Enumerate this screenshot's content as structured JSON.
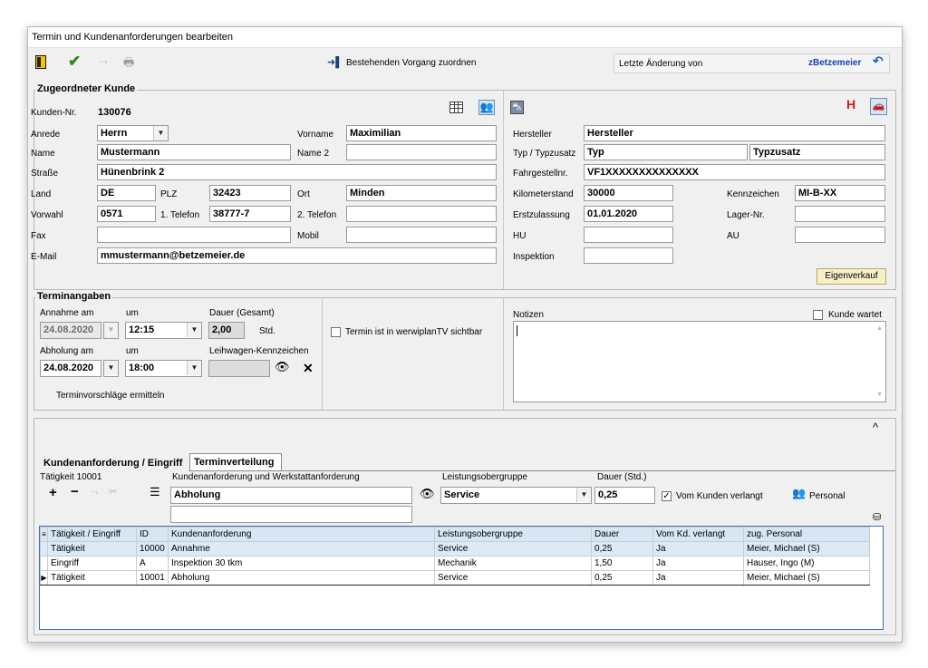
{
  "window": {
    "title": "Termin und Kundenanforderungen bearbeiten"
  },
  "toolbar": {
    "assign_label": "Bestehenden Vorgang zuordnen",
    "last_change_label": "Letzte Änderung von",
    "last_change_user": "zBetzemeier"
  },
  "customer": {
    "group_title": "Zugeordneter Kunde",
    "number_label": "Kunden-Nr.",
    "number": "130076",
    "salutation_label": "Anrede",
    "salutation": "Herrn",
    "firstname_label": "Vorname",
    "firstname": "Maximilian",
    "name_label": "Name",
    "name": "Mustermann",
    "name2_label": "Name 2",
    "name2": "",
    "street_label": "Straße",
    "street": "Hünenbrink 2",
    "country_label": "Land",
    "country": "DE",
    "zip_label": "PLZ",
    "zip": "32423",
    "city_label": "Ort",
    "city": "Minden",
    "areacode_label": "Vorwahl",
    "areacode": "0571",
    "phone1_label": "1. Telefon",
    "phone1": "38777-7",
    "phone2_label": "2. Telefon",
    "phone2": "",
    "fax_label": "Fax",
    "fax": "",
    "mobile_label": "Mobil",
    "mobile": "",
    "email_label": "E-Mail",
    "email": "mmustermann@betzemeier.de"
  },
  "vehicle": {
    "h_badge": "H",
    "maker_label": "Hersteller",
    "maker": "Hersteller",
    "type_label": "Typ / Typzusatz",
    "type": "Typ",
    "type_suffix": "Typzusatz",
    "vin_label": "Fahrgestellnr.",
    "vin": "VF1XXXXXXXXXXXXXX",
    "mileage_label": "Kilometerstand",
    "mileage": "30000",
    "plate_label": "Kennzeichen",
    "plate": "MI-B-XX",
    "reg_label": "Erstzulassung",
    "reg": "01.01.2020",
    "storage_label": "Lager-Nr.",
    "storage": "",
    "hu_label": "HU",
    "hu": "",
    "au_label": "AU",
    "au": "",
    "inspection_label": "Inspektion",
    "inspection": "",
    "own_sale_button": "Eigenverkauf"
  },
  "appointment": {
    "group_title": "Terminangaben",
    "accept_date_label": "Annahme am",
    "accept_date": "24.08.2020",
    "at_label": "um",
    "accept_time": "12:15",
    "duration_label": "Dauer (Gesamt)",
    "duration": "2,00",
    "duration_unit": "Std.",
    "tv_checkbox_label": "Termin ist in werwiplanTV sichtbar",
    "pickup_date_label": "Abholung am",
    "pickup_date": "24.08.2020",
    "pickup_at_label": "um",
    "pickup_time": "18:00",
    "loan_car_label": "Leihwagen-Kennzeichen",
    "loan_car": "",
    "suggest_label": "Terminvorschläge ermitteln",
    "notes_label": "Notizen",
    "notes": "",
    "waiting_label": "Kunde wartet"
  },
  "tabs": {
    "tab1": "Kundenanforderung / Eingriff",
    "tab2": "Terminverteilung"
  },
  "entry": {
    "activity_label": "Tätigkeit  10001",
    "request_label": "Kundenanforderung und Werkstattanforderung",
    "request_value": "Abholung",
    "request_value2": "",
    "group_label": "Leistungsobergruppe",
    "group_value": "Service",
    "duration_label": "Dauer (Std.)",
    "duration_value": "0,25",
    "customer_req_label": "Vom Kunden verlangt",
    "personal_label": "Personal"
  },
  "grid": {
    "columns": [
      "Tätigkeit / Eingriff",
      "ID",
      "Kundenanforderung",
      "Leistungsobergruppe",
      "Dauer",
      "Vom Kd. verlangt",
      "zug. Personal"
    ],
    "rows": [
      [
        "Tätigkeit",
        "10000",
        "Annahme",
        "Service",
        "0,25",
        "Ja",
        "Meier, Michael (S)"
      ],
      [
        "Eingriff",
        "A",
        "Inspektion 30 tkm",
        "Mechanik",
        "1,50",
        "Ja",
        "Hauser, Ingo (M)"
      ],
      [
        "Tätigkeit",
        "10001",
        "Abholung",
        "Service",
        "0,25",
        "Ja",
        "Meier, Michael (S)"
      ]
    ]
  }
}
